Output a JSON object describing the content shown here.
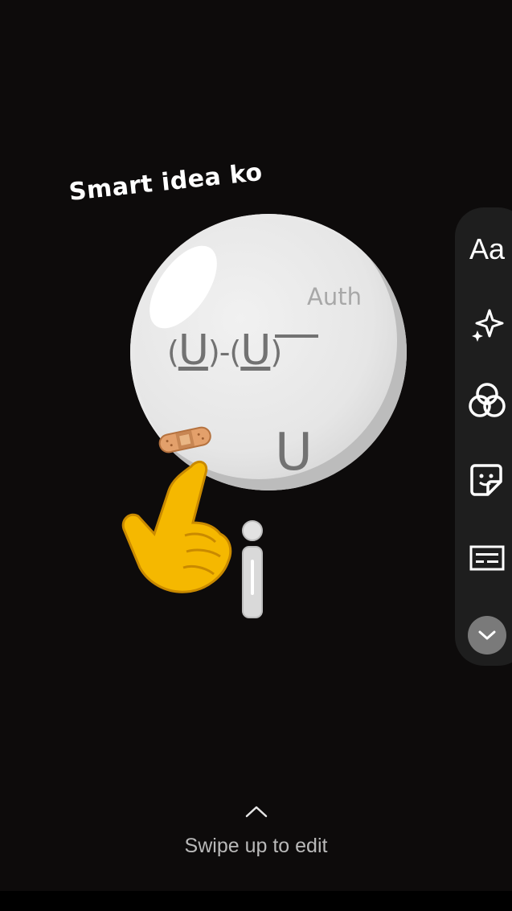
{
  "story": {
    "caption_text": "Smart idea ko",
    "sticker_watermark": "Auth",
    "sticker_face_left": "(",
    "sticker_face_u1": "U",
    "sticker_face_mid": ")-(",
    "sticker_face_u2": "U",
    "sticker_face_right": ")",
    "sticker_mouth": "U"
  },
  "toolbar": {
    "text_tool_label": "Aa",
    "items": [
      {
        "icon": "text-icon"
      },
      {
        "icon": "sparkle-effects-icon"
      },
      {
        "icon": "color-filter-icon"
      },
      {
        "icon": "sticker-icon"
      },
      {
        "icon": "caption-icon"
      },
      {
        "icon": "chevron-down-icon"
      }
    ]
  },
  "footer": {
    "swipe_hint": "Swipe up to edit"
  },
  "colors": {
    "background": "#0d0b0b",
    "toolbar_bg": "#1e1e1e",
    "hand_emoji": "#f5b800"
  }
}
